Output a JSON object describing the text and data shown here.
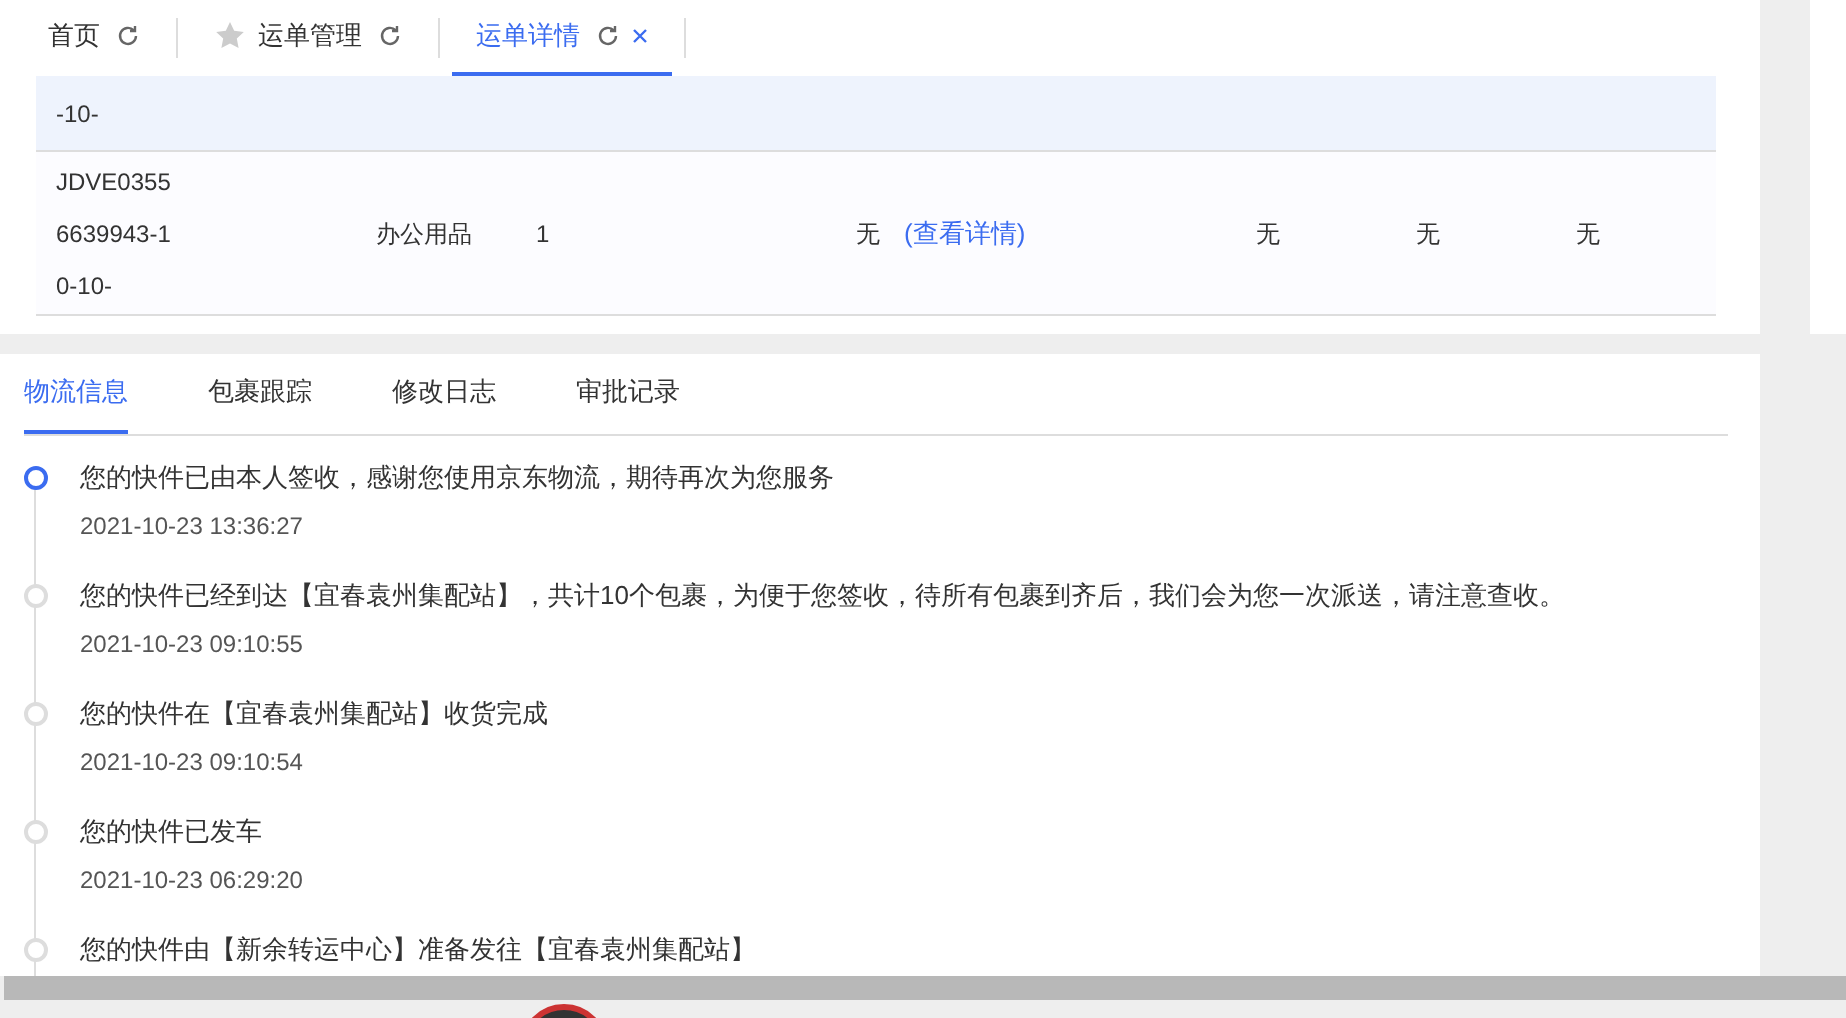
{
  "tabs": [
    {
      "label": "首页",
      "starred": false,
      "closable": false,
      "selected": false
    },
    {
      "label": "运单管理",
      "starred": true,
      "closable": false,
      "selected": false
    },
    {
      "label": "运单详情",
      "starred": false,
      "closable": true,
      "selected": true
    }
  ],
  "table": {
    "rows": [
      {
        "highlighted": true,
        "cells": [
          "-10-",
          "",
          "",
          "",
          "",
          "",
          "",
          ""
        ]
      },
      {
        "highlighted": false,
        "cells": [
          "JDVE0355\n6639943-1\n0-10-",
          "办公用品",
          "1",
          "无",
          "(查看详情)",
          "无",
          "无",
          "无"
        ]
      }
    ]
  },
  "detail_tabs": [
    {
      "label": "物流信息",
      "selected": true
    },
    {
      "label": "包裹跟踪",
      "selected": false
    },
    {
      "label": "修改日志",
      "selected": false
    },
    {
      "label": "审批记录",
      "selected": false
    }
  ],
  "timeline": [
    {
      "text": "您的快件已由本人签收，感谢您使用京东物流，期待再次为您服务",
      "time": "2021-10-23 13:36:27",
      "current": true
    },
    {
      "text": "您的快件已经到达【宜春袁州集配站】，共计10个包裹，为便于您签收，待所有包裹到齐后，我们会为您一次派送，请注意查收。",
      "time": "2021-10-23 09:10:55",
      "current": false
    },
    {
      "text": "您的快件在【宜春袁州集配站】收货完成",
      "time": "2021-10-23 09:10:54",
      "current": false
    },
    {
      "text": "您的快件已发车",
      "time": "2021-10-23 06:29:20",
      "current": false
    },
    {
      "text": "您的快件由【新余转运中心】准备发往【宜春袁州集配站】",
      "current": false
    }
  ]
}
